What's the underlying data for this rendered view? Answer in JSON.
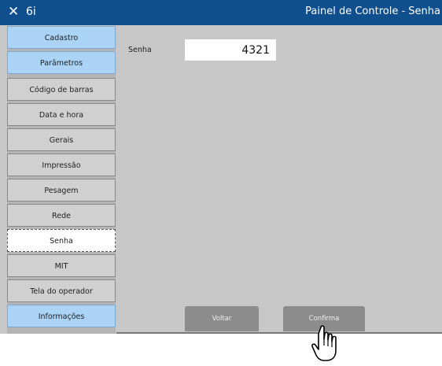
{
  "window": {
    "close_glyph": "✕",
    "app_name": "6i",
    "title": "Painel de Controle - Senha"
  },
  "sidebar": {
    "items": [
      {
        "label": "Cadastro",
        "style": "blue"
      },
      {
        "label": "Parâmetros",
        "style": "blue"
      },
      {
        "label": "Código de barras",
        "style": "gray"
      },
      {
        "label": "Data e hora",
        "style": "gray"
      },
      {
        "label": "Gerais",
        "style": "gray"
      },
      {
        "label": "Impressão",
        "style": "gray"
      },
      {
        "label": "Pesagem",
        "style": "gray"
      },
      {
        "label": "Rede",
        "style": "gray"
      },
      {
        "label": "Senha",
        "style": "active"
      },
      {
        "label": "MIT",
        "style": "gray"
      },
      {
        "label": "Tela do operador",
        "style": "gray"
      },
      {
        "label": "Informações",
        "style": "blue"
      }
    ]
  },
  "form": {
    "senha_label": "Senha",
    "senha_value": "4321"
  },
  "buttons": {
    "voltar": "Voltar",
    "confirma": "Confirma"
  },
  "colors": {
    "titlebar": "#0f4f8e",
    "sidebar_blue": "#aad3f5",
    "panel": "#c7c7c7"
  }
}
